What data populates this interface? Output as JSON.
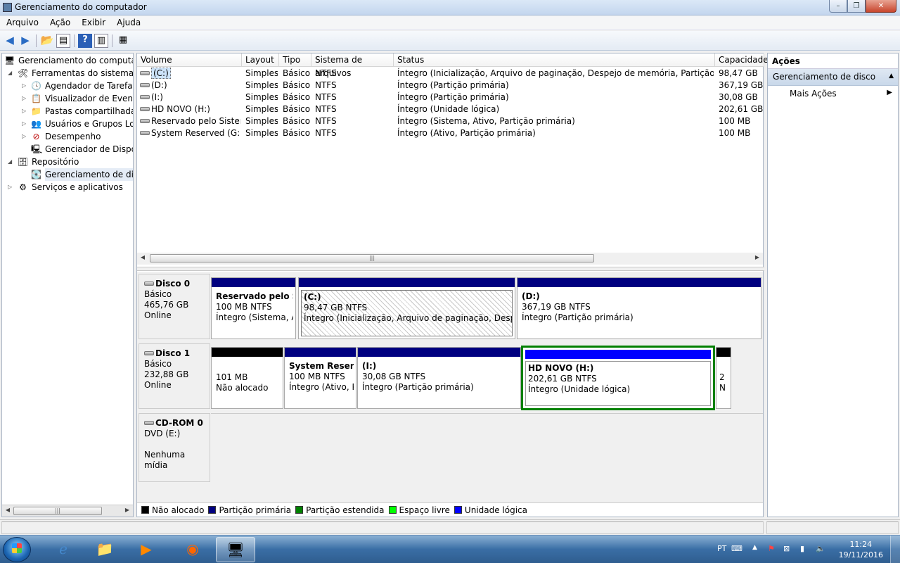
{
  "window": {
    "title": "Gerenciamento do computador",
    "btn_min": "–",
    "btn_max": "❐",
    "btn_close": "✕"
  },
  "menu": [
    "Arquivo",
    "Ação",
    "Exibir",
    "Ajuda"
  ],
  "tree": [
    {
      "label": "Gerenciamento do computador",
      "arrow": "",
      "icon": "🖥",
      "level": 0
    },
    {
      "label": "Ferramentas do sistema",
      "arrow": "◢",
      "icon": "🛠",
      "level": 1
    },
    {
      "label": "Agendador de Tarefas",
      "arrow": "▷",
      "icon": "🕓",
      "level": 2
    },
    {
      "label": "Visualizador de Eventos",
      "arrow": "▷",
      "icon": "📋",
      "level": 2
    },
    {
      "label": "Pastas compartilhadas",
      "arrow": "▷",
      "icon": "📁",
      "level": 2
    },
    {
      "label": "Usuários e Grupos Loca",
      "arrow": "▷",
      "icon": "👥",
      "level": 2
    },
    {
      "label": "Desempenho",
      "arrow": "▷",
      "icon": "⊘",
      "level": 2
    },
    {
      "label": "Gerenciador de Disposit",
      "arrow": "",
      "icon": "🖳",
      "level": 2
    },
    {
      "label": "Repositório",
      "arrow": "◢",
      "icon": "🗄",
      "level": 1
    },
    {
      "label": "Gerenciamento de disco",
      "arrow": "",
      "icon": "💽",
      "level": 2,
      "selected": true
    },
    {
      "label": "Serviços e aplicativos",
      "arrow": "▷",
      "icon": "⚙",
      "level": 1
    }
  ],
  "columns": [
    "Volume",
    "Layout",
    "Tipo",
    "Sistema de arquivos",
    "Status",
    "Capacidade"
  ],
  "volumes": [
    {
      "volume": "(C:)",
      "layout": "Simples",
      "tipo": "Básico",
      "fs": "NTFS",
      "status": "Íntegro (Inicialização, Arquivo de paginação, Despejo de memória, Partição primária)",
      "cap": "98,47 GB"
    },
    {
      "volume": "(D:)",
      "layout": "Simples",
      "tipo": "Básico",
      "fs": "NTFS",
      "status": "Íntegro (Partição primária)",
      "cap": "367,19 GB"
    },
    {
      "volume": "(I:)",
      "layout": "Simples",
      "tipo": "Básico",
      "fs": "NTFS",
      "status": "Íntegro (Partição primária)",
      "cap": "30,08 GB"
    },
    {
      "volume": "HD NOVO  (H:)",
      "layout": "Simples",
      "tipo": "Básico",
      "fs": "NTFS",
      "status": "Íntegro (Unidade lógica)",
      "cap": "202,61 GB"
    },
    {
      "volume": "Reservado pelo Sistema",
      "layout": "Simples",
      "tipo": "Básico",
      "fs": "NTFS",
      "status": "Íntegro (Sistema, Ativo, Partição primária)",
      "cap": "100 MB"
    },
    {
      "volume": "System Reserved (G:)",
      "layout": "Simples",
      "tipo": "Básico",
      "fs": "NTFS",
      "status": "Íntegro (Ativo, Partição primária)",
      "cap": "100 MB"
    }
  ],
  "disks": {
    "disk0": {
      "name": "Disco 0",
      "type": "Básico",
      "size": "465,76 GB",
      "state": "Online",
      "parts": [
        {
          "title": "Reservado pelo Sist",
          "size": "100 MB NTFS",
          "status": "Íntegro (Sistema, Ati"
        },
        {
          "title": "(C:)",
          "size": "98,47 GB NTFS",
          "status": "Íntegro (Inicialização, Arquivo de paginação, Despejo de"
        },
        {
          "title": "(D:)",
          "size": "367,19 GB NTFS",
          "status": "Íntegro (Partição primária)"
        }
      ]
    },
    "disk1": {
      "name": "Disco 1",
      "type": "Básico",
      "size": "232,88 GB",
      "state": "Online",
      "parts": [
        {
          "title": "",
          "size": "101 MB",
          "status": "Não alocado"
        },
        {
          "title": "System Reserve",
          "size": "100 MB NTFS",
          "status": "Íntegro (Ativo, Pi"
        },
        {
          "title": "(I:)",
          "size": "30,08 GB NTFS",
          "status": "Íntegro (Partição primária)"
        },
        {
          "title": "HD NOVO  (H:)",
          "size": "202,61 GB NTFS",
          "status": "Íntegro (Unidade lógica)"
        },
        {
          "title": "",
          "size": "2",
          "status": "N"
        }
      ]
    },
    "cdrom": {
      "name": "CD-ROM 0",
      "type": "DVD (E:)",
      "media": "Nenhuma mídia"
    }
  },
  "legend": [
    {
      "label": "Não alocado",
      "color": "#000000"
    },
    {
      "label": "Partição primária",
      "color": "#000080"
    },
    {
      "label": "Partição estendida",
      "color": "#008000"
    },
    {
      "label": "Espaço livre",
      "color": "#00ff00"
    },
    {
      "label": "Unidade lógica",
      "color": "#0000ff"
    }
  ],
  "actions": {
    "title": "Ações",
    "section": "Gerenciamento de disco",
    "item": "Mais Ações"
  },
  "taskbar": {
    "lang": "PT",
    "time": "11:24",
    "date": "19/11/2016"
  },
  "colors": {
    "primary": "#000080",
    "logical": "#0000ff",
    "extended": "#008000",
    "unallocated": "#000000"
  }
}
